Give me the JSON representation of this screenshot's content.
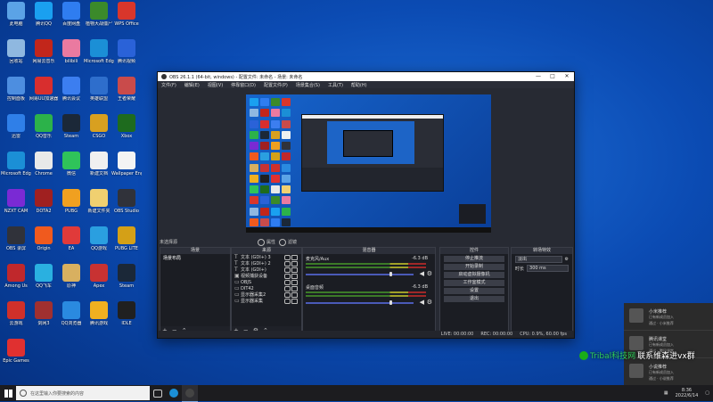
{
  "desktop_icons": [
    {
      "label": "此电脑",
      "color": "#5ba3e6"
    },
    {
      "label": "腾讯QQ",
      "color": "#1aa0f0"
    },
    {
      "label": "百度网盘",
      "color": "#2f7df0"
    },
    {
      "label": "植物大战僵尸",
      "color": "#3b8a2a"
    },
    {
      "label": "WPS Office",
      "color": "#d8362b"
    },
    {
      "label": "回收站",
      "color": "#8fb8e0"
    },
    {
      "label": "网易云音乐",
      "color": "#c2261b"
    },
    {
      "label": "bilibili",
      "color": "#ea7aa0"
    },
    {
      "label": "Microsoft Edge",
      "color": "#1b8fd6"
    },
    {
      "label": "腾讯视频",
      "color": "#2a62d8"
    },
    {
      "label": "控制面板",
      "color": "#4d8ee0"
    },
    {
      "label": "网易UU加速器",
      "color": "#d82e2e"
    },
    {
      "label": "腾讯会议",
      "color": "#3c7ef0"
    },
    {
      "label": "英雄联盟",
      "color": "#2e6ecc"
    },
    {
      "label": "王者荣耀",
      "color": "#c94b4b"
    },
    {
      "label": "迅雷",
      "color": "#2f7fe8"
    },
    {
      "label": "QQ音乐",
      "color": "#2cb24a"
    },
    {
      "label": "Steam",
      "color": "#1b2838"
    },
    {
      "label": "CSGO",
      "color": "#d8a020"
    },
    {
      "label": "Xbox",
      "color": "#1e6b1e"
    },
    {
      "label": "Microsoft Edge",
      "color": "#1b8fd6"
    },
    {
      "label": "Chrome",
      "color": "#e9e9e9"
    },
    {
      "label": "微信",
      "color": "#2fc35a"
    },
    {
      "label": "新建文档",
      "color": "#f0f0f0"
    },
    {
      "label": "Wallpaper Engine",
      "color": "#f4f4f4"
    },
    {
      "label": "NZXT CAM",
      "color": "#7a2ad4"
    },
    {
      "label": "DOTA2",
      "color": "#a02020"
    },
    {
      "label": "PUBG",
      "color": "#f0a020"
    },
    {
      "label": "新建文件夹",
      "color": "#f0d070"
    },
    {
      "label": "OBS Studio",
      "color": "#30323a"
    },
    {
      "label": "OBS 录屏",
      "color": "#30323a"
    },
    {
      "label": "Origin",
      "color": "#f05a1e"
    },
    {
      "label": "EA",
      "color": "#e03a3a"
    },
    {
      "label": "QQ游戏",
      "color": "#2a9fe0"
    },
    {
      "label": "PUBG LITE",
      "color": "#d4a017"
    },
    {
      "label": "Among Us",
      "color": "#c0282c"
    },
    {
      "label": "QQ飞车",
      "color": "#2ab0e0"
    },
    {
      "label": "原神",
      "color": "#d8b060"
    },
    {
      "label": "Apex",
      "color": "#c83232"
    },
    {
      "label": "Steam",
      "color": "#1b2838"
    },
    {
      "label": "云游戏",
      "color": "#d0302a"
    },
    {
      "label": "剑网3",
      "color": "#a03030"
    },
    {
      "label": "QQ浏览器",
      "color": "#2a8ae0"
    },
    {
      "label": "腾讯游戏",
      "color": "#f0b020"
    },
    {
      "label": "IDLE",
      "color": "#202020"
    },
    {
      "label": "Epic Games",
      "color": "#e03030"
    }
  ],
  "obs": {
    "title": "OBS 26.1.1 (64-bit, windows) - 配置文件: 未命名 - 场景: 未命名",
    "menu": [
      "文件(F)",
      "编辑(E)",
      "视图(V)",
      "停靠窗口(D)",
      "配置文件(P)",
      "场景集合(S)",
      "工具(T)",
      "帮助(H)"
    ],
    "no_source": "未选择源",
    "properties_label": "属性",
    "filters_label": "滤镜",
    "scenes_header": "场景",
    "sources_header": "来源",
    "mixer_header": "混音器",
    "controls_header": "控件",
    "transitions_header": "转场特效",
    "scene_item": "场景布局",
    "sources": [
      {
        "sym": "T",
        "name": "文本 (GDI+) 3"
      },
      {
        "sym": "T",
        "name": "文本 (GDI+) 2"
      },
      {
        "sym": "T",
        "name": "文本 (GDI+)"
      },
      {
        "sym": "▣",
        "name": "视频捕获设备"
      },
      {
        "sym": "▭",
        "name": "OBJS"
      },
      {
        "sym": "▭",
        "name": "DIT42"
      },
      {
        "sym": "▭",
        "name": "显示器采集2"
      },
      {
        "sym": "▭",
        "name": "显示器采集"
      }
    ],
    "mixer": [
      {
        "name": "麦克风/Aux",
        "db": "-6.3 dB"
      },
      {
        "name": "桌面音频",
        "db": "-6.3 dB"
      }
    ],
    "controls": [
      "停止推流",
      "开始录制",
      "启动虚拟摄像机",
      "工作室模式",
      "设置",
      "退出"
    ],
    "transition_type": "淡出",
    "duration_label": "时长",
    "duration_value": "300 ms",
    "status": {
      "live": "LIVE: 00:00:00",
      "rec": "REC: 00:00:00",
      "cpu": "CPU: 0.9%, 60.00 fps"
    }
  },
  "notifications": [
    {
      "title": "小米推荐",
      "desc": "已有新成员加入",
      "via": "通过 · 小米推荐"
    },
    {
      "title": "腾讯课堂",
      "desc": "已有新成员加入",
      "via": "通过 · 腾讯课堂"
    },
    {
      "title": "小说推荐",
      "desc": "已有新成员加入",
      "via": "通过 · 小说推荐"
    }
  ],
  "watermark": {
    "green": "Tribal科技网",
    "white": "联系维森进vx群"
  },
  "taskbar": {
    "search_placeholder": "在这里输入你要搜索的内容",
    "time": "8:36",
    "date": "2022/6/14"
  }
}
